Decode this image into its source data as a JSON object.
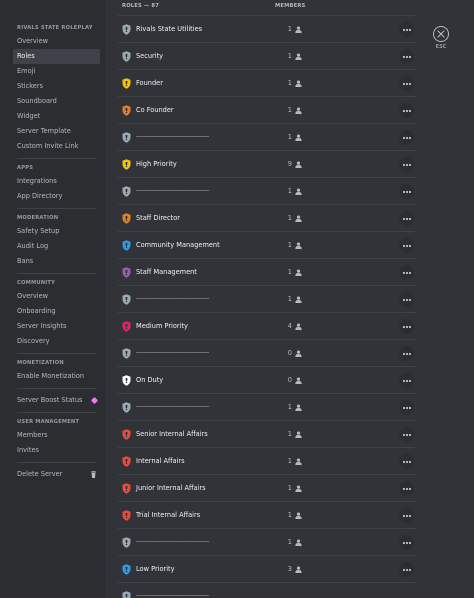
{
  "sidebar": {
    "server_name": "RIVALS STATE ROLEPLAY",
    "server_items": [
      "Overview",
      "Roles",
      "Emoji",
      "Stickers",
      "Soundboard",
      "Widget",
      "Server Template",
      "Custom Invite Link"
    ],
    "apps_head": "APPS",
    "apps_items": [
      "Integrations",
      "App Directory"
    ],
    "moderation_head": "MODERATION",
    "moderation_items": [
      "Safety Setup",
      "Audit Log",
      "Bans"
    ],
    "community_head": "COMMUNITY",
    "community_items": [
      "Overview",
      "Onboarding",
      "Server Insights",
      "Discovery"
    ],
    "monetization_head": "MONETIZATION",
    "monetization_items": [
      "Enable Monetization"
    ],
    "boost_label": "Server Boost Status",
    "user_mgmt_head": "USER MANAGEMENT",
    "user_mgmt_items": [
      "Members",
      "Invites"
    ],
    "delete_label": "Delete Server"
  },
  "header": {
    "roles_col": "ROLES — 87",
    "members_col": "MEMBERS"
  },
  "roles": [
    {
      "name": "Rivals State Utilities",
      "count": "1",
      "color": "#99aab5"
    },
    {
      "name": "Security",
      "count": "1",
      "color": "#99aab5"
    },
    {
      "name": "Founder",
      "count": "1",
      "color": "#f1c40f"
    },
    {
      "name": "Co Founder",
      "count": "1",
      "color": "#e67e22"
    },
    {
      "name": "——————————————",
      "count": "1",
      "color": "#99aab5"
    },
    {
      "name": "High Priority",
      "count": "9",
      "color": "#f1c40f"
    },
    {
      "name": "——————————————",
      "count": "1",
      "color": "#99aab5"
    },
    {
      "name": "Staff Director",
      "count": "1",
      "color": "#e67e22"
    },
    {
      "name": "Community Management",
      "count": "1",
      "color": "#3498db"
    },
    {
      "name": "Staff Management",
      "count": "1",
      "color": "#9b59b6"
    },
    {
      "name": "——————————————",
      "count": "1",
      "color": "#99aab5"
    },
    {
      "name": "Medium Priority",
      "count": "4",
      "color": "#e91e63"
    },
    {
      "name": "——————————————",
      "count": "0",
      "color": "#99aab5"
    },
    {
      "name": "On Duty",
      "count": "0",
      "color": "#ffffff"
    },
    {
      "name": "——————————————",
      "count": "1",
      "color": "#99aab5"
    },
    {
      "name": "Senior Internal Affairs",
      "count": "1",
      "color": "#e74c3c"
    },
    {
      "name": "Internal Affairs",
      "count": "1",
      "color": "#e74c3c"
    },
    {
      "name": "Junior Internal Affairs",
      "count": "1",
      "color": "#e74c3c"
    },
    {
      "name": "Trial Internal Affairs",
      "count": "1",
      "color": "#e74c3c"
    },
    {
      "name": "——————————————",
      "count": "1",
      "color": "#99aab5"
    },
    {
      "name": "Low Priority",
      "count": "3",
      "color": "#3498db"
    },
    {
      "name": "——————————————",
      "count": "",
      "color": "#99aab5"
    }
  ],
  "close": {
    "label": "ESC"
  }
}
